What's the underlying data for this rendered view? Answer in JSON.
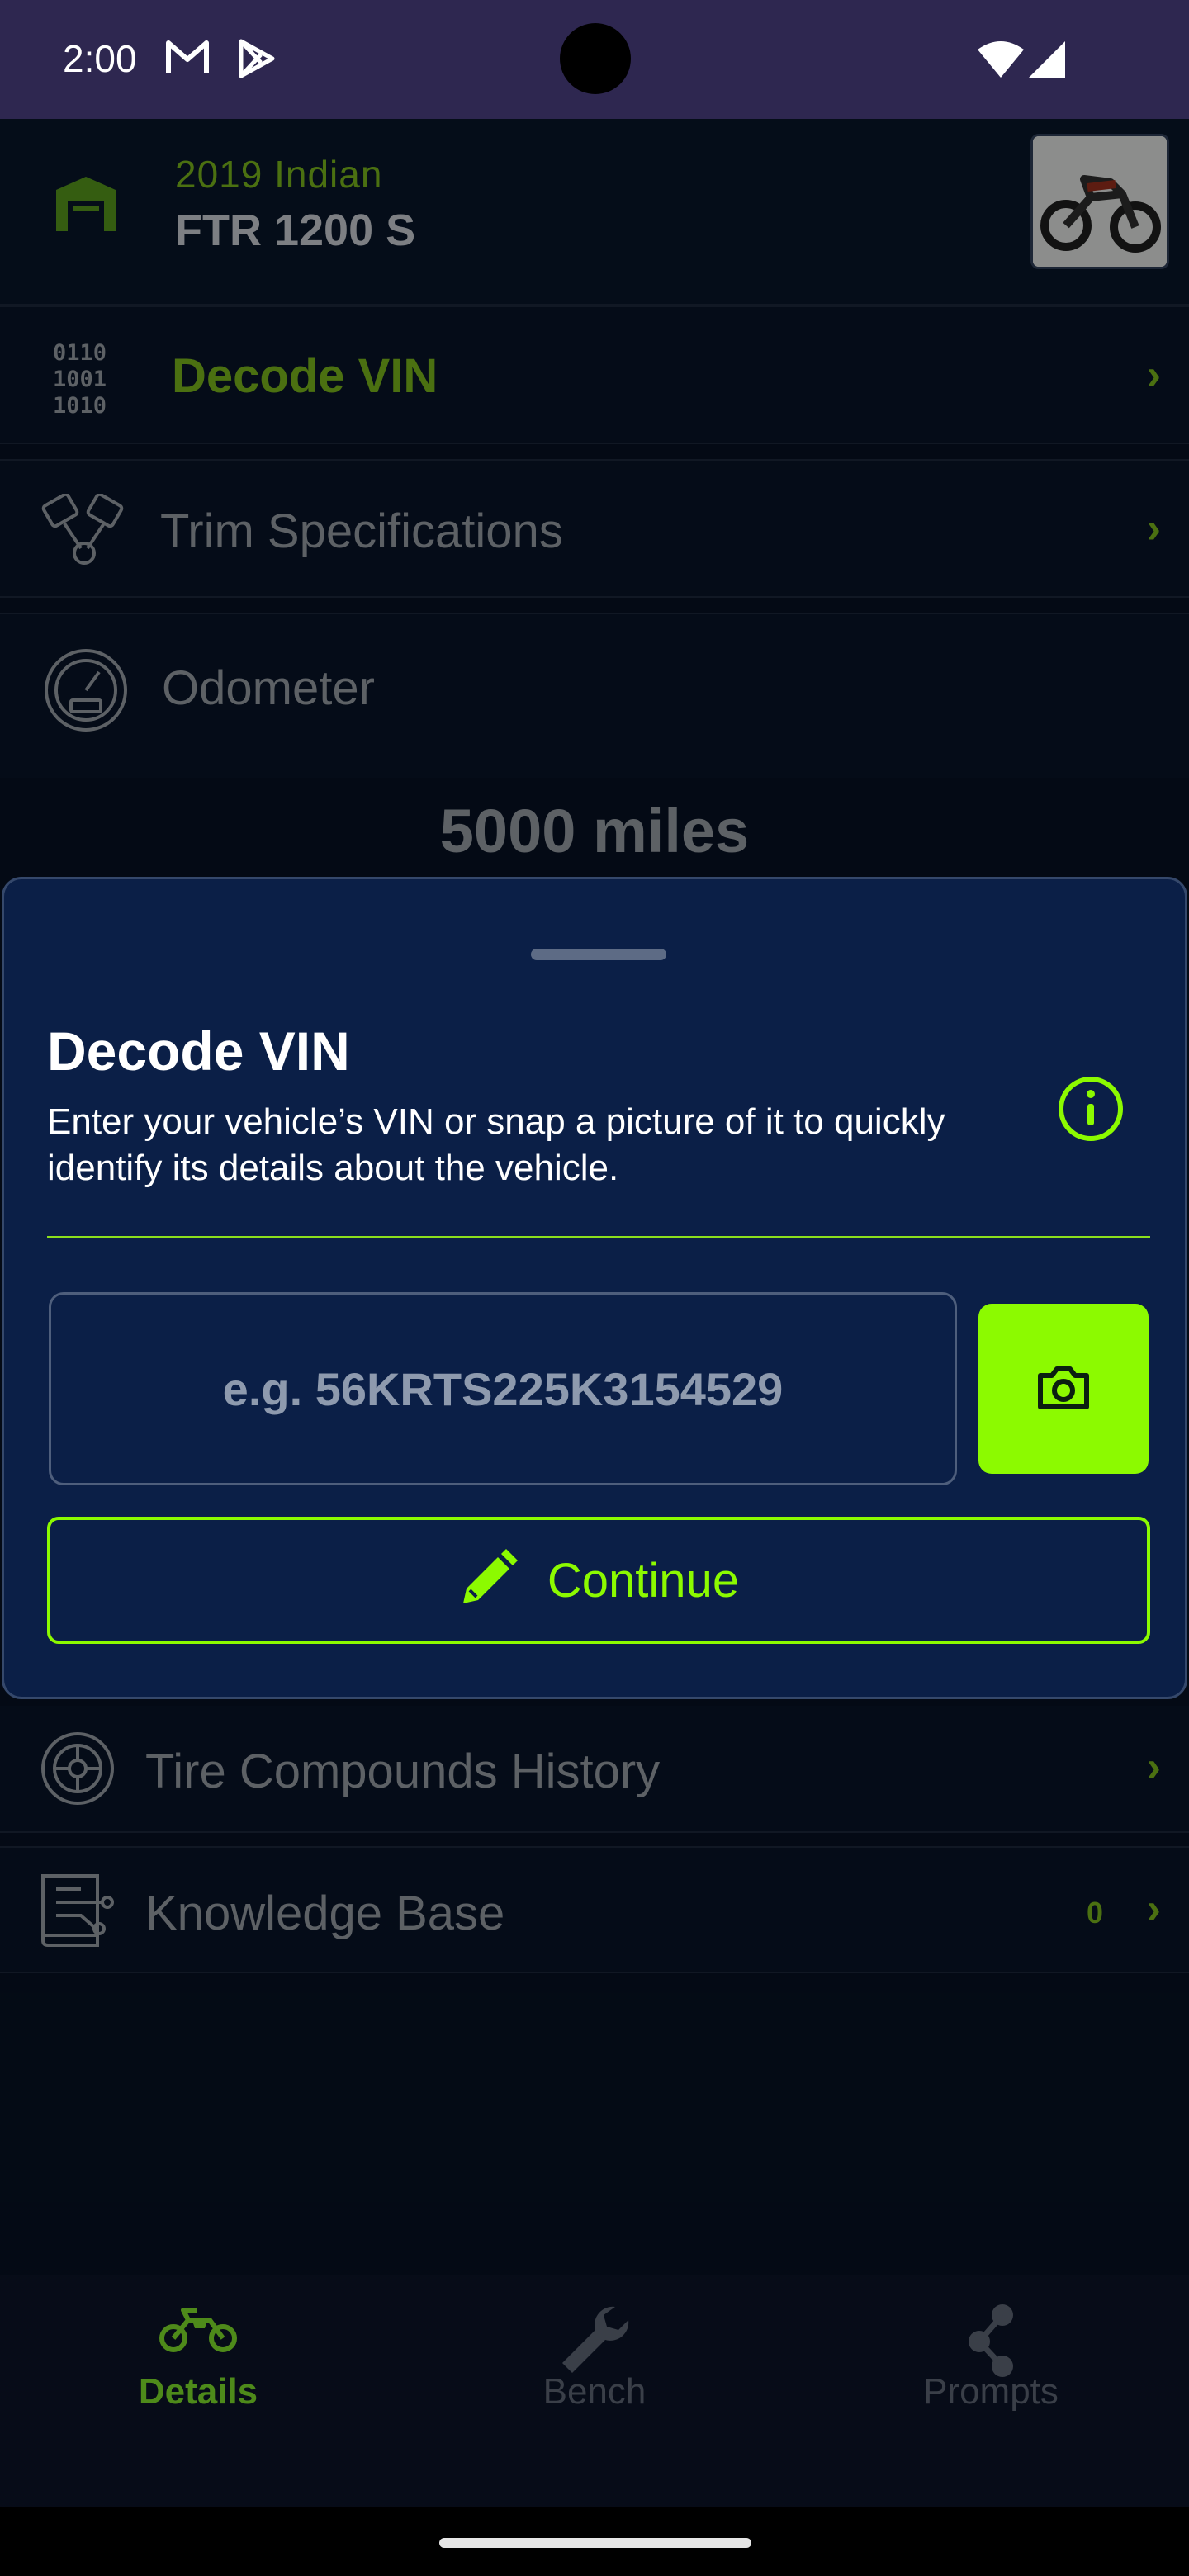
{
  "status_bar": {
    "time": "2:00",
    "left_icons": [
      "gmail-icon",
      "play-store-icon"
    ],
    "right_icons": [
      "wifi-icon",
      "cellular-signal-icon"
    ]
  },
  "vehicle": {
    "year_make": "2019 Indian",
    "model": "FTR 1200 S",
    "thumbnail_icon": "motorcycle-photo"
  },
  "rows": {
    "decode_vin": {
      "label": "Decode VIN",
      "icon": "binary-code-icon"
    },
    "trim_specifications": {
      "label": "Trim Specifications",
      "icon": "pistons-icon"
    },
    "odometer": {
      "label": "Odometer",
      "icon": "speedometer-icon",
      "value": "5000 miles"
    },
    "tire_compounds_history": {
      "label": "Tire Compounds History",
      "icon": "tire-icon"
    },
    "knowledge_base": {
      "label": "Knowledge Base",
      "icon": "knowledge-book-icon",
      "count": "0"
    }
  },
  "decode_vin_sheet": {
    "title": "Decode VIN",
    "description": "Enter your vehicle’s VIN or snap a picture of it to quickly identify its details about the vehicle.",
    "vin_placeholder": "e.g. 56KRTS225K3154529",
    "vin_value": "",
    "continue_label": "Continue",
    "accent_color": "#8cfa00"
  },
  "bottom_nav": {
    "items": [
      {
        "label": "Details",
        "icon": "motorcycle-icon",
        "active": true
      },
      {
        "label": "Bench",
        "icon": "wrench-icon",
        "active": false
      },
      {
        "label": "Prompts",
        "icon": "share-nodes-icon",
        "active": false
      }
    ]
  },
  "colors": {
    "status_bar": "#2e2750",
    "background": "#06101f",
    "sheet_background": "#0b1f47",
    "accent": "#8cfa00",
    "accent_dim": "#6fa61a",
    "muted_text": "#8a8f96"
  }
}
